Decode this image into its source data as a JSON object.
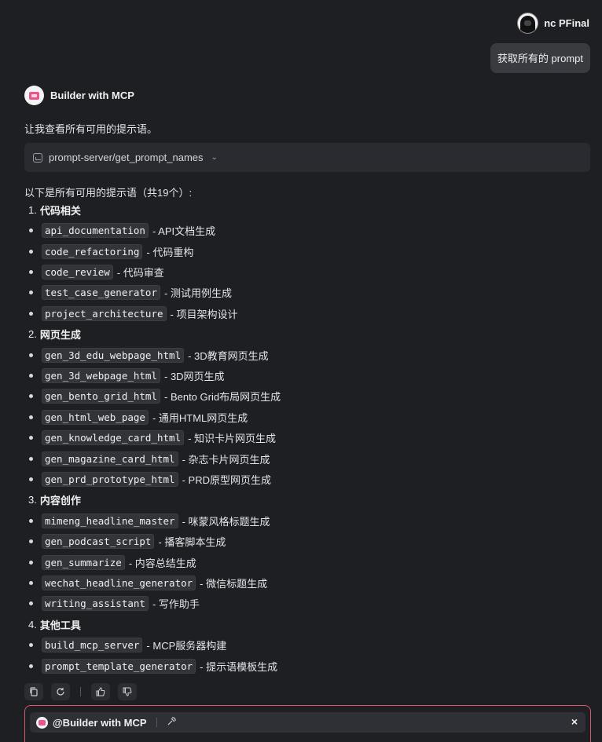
{
  "user": {
    "name": "nc PFinal",
    "message": "获取所有的 prompt"
  },
  "assistant": {
    "name": "Builder with MCP",
    "intro": "让我查看所有可用的提示语。",
    "tool_call": "prompt-server/get_prompt_names",
    "summary": "以下是所有可用的提示语（共19个）:"
  },
  "sections": [
    {
      "num": "1.",
      "title": "代码相关",
      "items": [
        {
          "code": "api_documentation",
          "desc": "- API文档生成"
        },
        {
          "code": "code_refactoring",
          "desc": "- 代码重构"
        },
        {
          "code": "code_review",
          "desc": "- 代码审查"
        },
        {
          "code": "test_case_generator",
          "desc": "- 测试用例生成"
        },
        {
          "code": "project_architecture",
          "desc": "- 项目架构设计"
        }
      ]
    },
    {
      "num": "2.",
      "title": "网页生成",
      "items": [
        {
          "code": "gen_3d_edu_webpage_html",
          "desc": "- 3D教育网页生成"
        },
        {
          "code": "gen_3d_webpage_html",
          "desc": "- 3D网页生成"
        },
        {
          "code": "gen_bento_grid_html",
          "desc": "- Bento Grid布局网页生成"
        },
        {
          "code": "gen_html_web_page",
          "desc": "- 通用HTML网页生成"
        },
        {
          "code": "gen_knowledge_card_html",
          "desc": "- 知识卡片网页生成"
        },
        {
          "code": "gen_magazine_card_html",
          "desc": "- 杂志卡片网页生成"
        },
        {
          "code": "gen_prd_prototype_html",
          "desc": "- PRD原型网页生成"
        }
      ]
    },
    {
      "num": "3.",
      "title": "内容创作",
      "items": [
        {
          "code": "mimeng_headline_master",
          "desc": "- 咪蒙风格标题生成"
        },
        {
          "code": "gen_podcast_script",
          "desc": "- 播客脚本生成"
        },
        {
          "code": "gen_summarize",
          "desc": "- 内容总结生成"
        },
        {
          "code": "wechat_headline_generator",
          "desc": "- 微信标题生成"
        },
        {
          "code": "writing_assistant",
          "desc": "- 写作助手"
        }
      ]
    },
    {
      "num": "4.",
      "title": "其他工具",
      "items": [
        {
          "code": "build_mcp_server",
          "desc": "- MCP服务器构建"
        },
        {
          "code": "prompt_template_generator",
          "desc": "- 提示语模板生成"
        }
      ]
    }
  ],
  "actions": {
    "icons": [
      "copy-icon",
      "refresh-icon",
      "thumbs-up-icon",
      "thumbs-down-icon"
    ]
  },
  "composer": {
    "mention": "@Builder with MCP",
    "close": "×"
  }
}
